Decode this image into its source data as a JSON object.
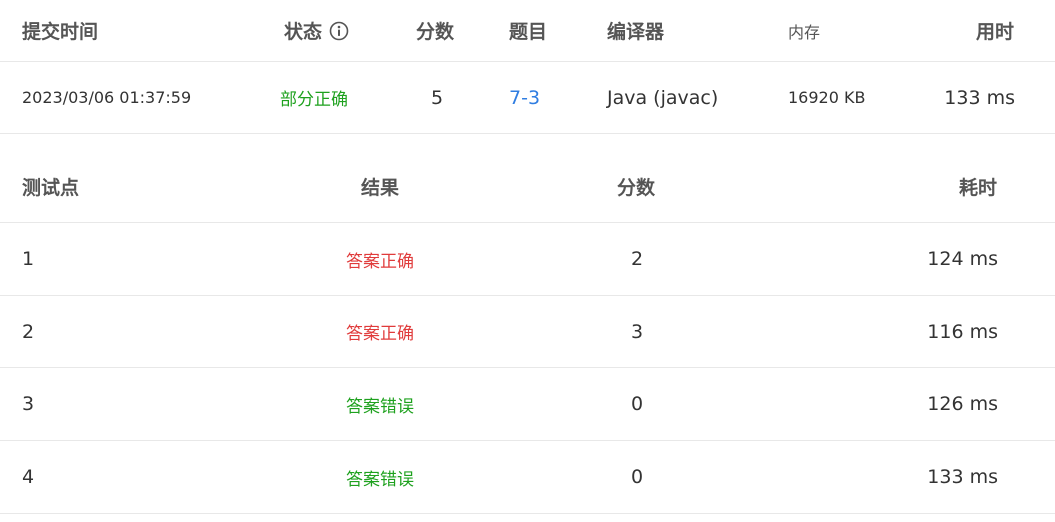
{
  "colors": {
    "status_partial": "#1ea11e",
    "link": "#2f7de1",
    "accepted": "#e03b3b",
    "wrong": "#1ea11e"
  },
  "submission": {
    "headers": {
      "time": "提交时间",
      "status": "状态",
      "score": "分数",
      "problem": "题目",
      "compiler": "编译器",
      "memory": "内存",
      "runtime": "用时"
    },
    "status_info_icon": "info-circle-icon",
    "row": {
      "time": "2023/03/06 01:37:59",
      "status": "部分正确",
      "score": "5",
      "problem": "7-3",
      "compiler": "Java (javac)",
      "memory": "16920 KB",
      "runtime": "133 ms"
    }
  },
  "testcases": {
    "headers": {
      "case": "测试点",
      "result": "结果",
      "score": "分数",
      "time": "耗时"
    },
    "rows": [
      {
        "case": "1",
        "result": "答案正确",
        "score": "2",
        "time": "124 ms"
      },
      {
        "case": "2",
        "result": "答案正确",
        "score": "3",
        "time": "116 ms"
      },
      {
        "case": "3",
        "result": "答案错误",
        "score": "0",
        "time": "126 ms"
      },
      {
        "case": "4",
        "result": "答案错误",
        "score": "0",
        "time": "133 ms"
      }
    ]
  }
}
